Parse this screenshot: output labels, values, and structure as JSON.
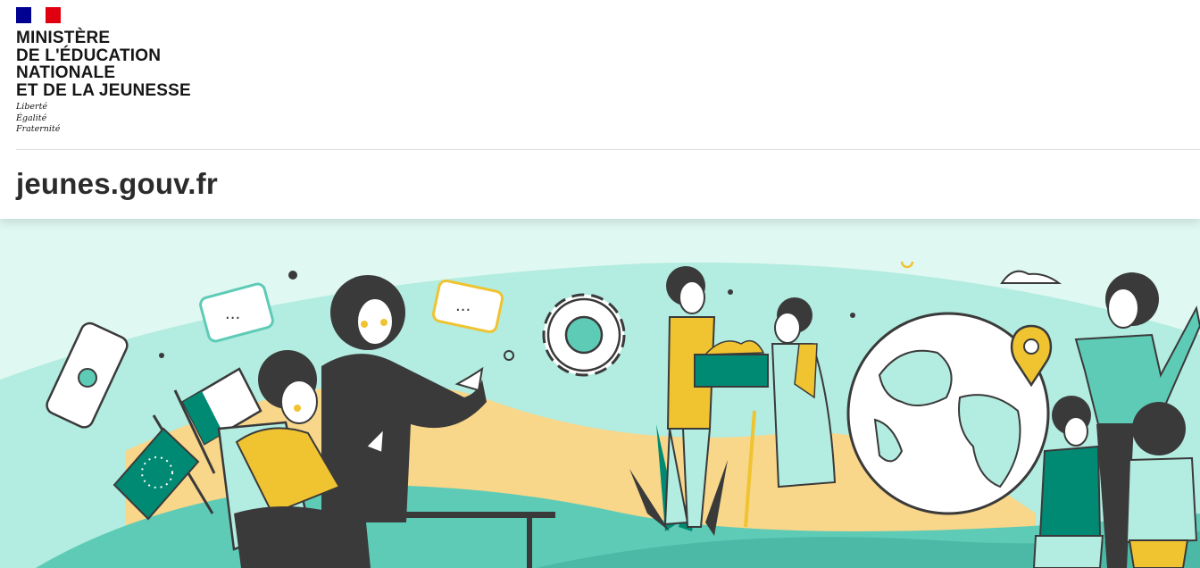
{
  "header": {
    "flag_colors": [
      "#000091",
      "#ffffff",
      "#e1000f"
    ],
    "ministry_lines": [
      "MINISTÈRE",
      "DE L'ÉDUCATION",
      "NATIONALE",
      "ET DE LA JEUNESSE"
    ],
    "motto_lines": [
      "Liberté",
      "Égalité",
      "Fraternité"
    ],
    "site_name": "jeunes.gouv.fr"
  },
  "hero": {
    "speech_bubble_1": "...",
    "speech_bubble_2": "...",
    "colors": {
      "background": "#dff8f1",
      "teal": "#5ecbb7",
      "dark_teal": "#008a73",
      "yellow": "#f0c330",
      "sand": "#f8d68a",
      "ink": "#3a3a3a"
    },
    "icons": [
      "diploma-icon",
      "flag-icon",
      "eu-flag-icon",
      "gear-icon",
      "globe-icon",
      "location-pin-icon"
    ]
  }
}
